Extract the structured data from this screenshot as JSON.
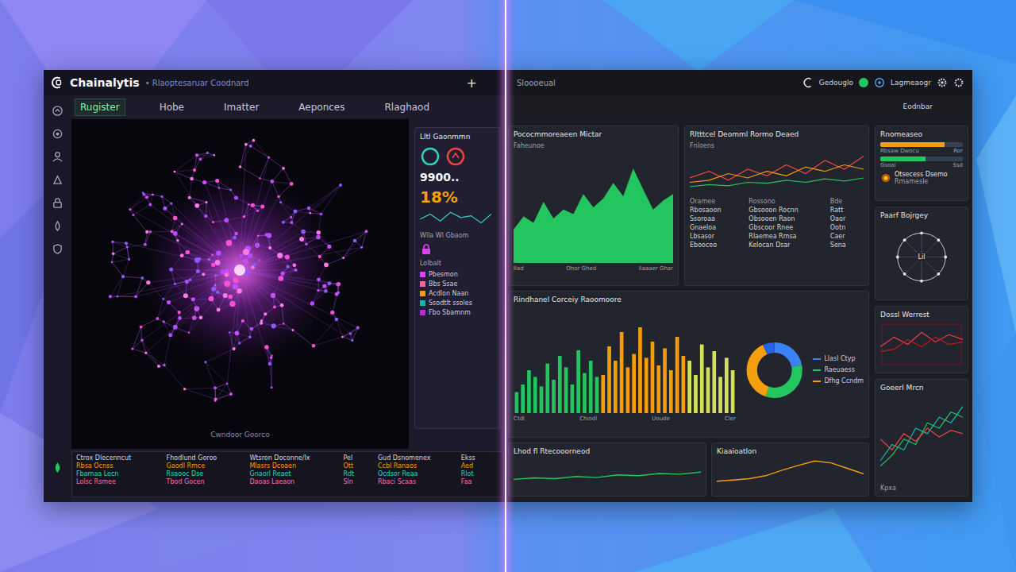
{
  "window": {
    "logo": "Chainalytis",
    "subtitle": "• Rlaoptesaruar Coodnard",
    "add_icon": "+",
    "status_text": "Sloooeual"
  },
  "user_menu": {
    "name": "Gedouglo",
    "online": true,
    "account": "Lagmeaogr"
  },
  "nav_tabs": [
    {
      "label": "Rugister",
      "selected": true
    },
    {
      "label": "Hobe",
      "selected": false
    },
    {
      "label": "Imatter",
      "selected": false
    },
    {
      "label": "Aeponces",
      "selected": false
    },
    {
      "label": "Rlaghaod",
      "selected": false
    }
  ],
  "page_label": "Eodnbar",
  "network": {
    "caption": "Cwndoor Goorco"
  },
  "stats_panel": {
    "title": "Lltl Gaonmmn",
    "total": "9900..",
    "change": "18%",
    "spark": [
      5,
      8,
      4,
      9,
      6,
      7,
      3,
      8
    ],
    "note": "Wlla Wl Gbaom",
    "legend_title": "Lolbalt",
    "legend": [
      {
        "label": "Pbesmon",
        "color": "#e040fb"
      },
      {
        "label": "Bbs Ssae",
        "color": "#ff5fa2"
      },
      {
        "label": "Acdlon Naan",
        "color": "#f59e0b"
      },
      {
        "label": "Ssodtlt ssoles",
        "color": "#14b8a6"
      },
      {
        "label": "Fbo Sbamnm",
        "color": "#c026d3"
      }
    ]
  },
  "activity_table": {
    "columns": [
      "Ctrox Dlecenncut",
      "Fhodlund Goroo",
      "Wtsron Doconne/Ix",
      "Pel",
      "Gud Dsnomenex",
      "Ekss"
    ],
    "rows": [
      {
        "cells": [
          "Rbsa Ocnss",
          "Gaodl Rmce",
          "Mlasrs Dcoaen",
          "Ott",
          "Ccbl Ranaos",
          "Aed"
        ],
        "color": "#f59e0b"
      },
      {
        "cells": [
          "Fbamaa Lecn",
          "Rsaooc Dse",
          "Gnaorl Reaet",
          "Rdt",
          "Ocdsor Reaa",
          "Rlot"
        ],
        "color": "#2dd4bf"
      },
      {
        "cells": [
          "Lolsc Rsmee",
          "Tbod Gocen",
          "Daoas Laeaon",
          "Sln",
          "Rbaci Scaas",
          "Faa"
        ],
        "color": "#f472b6"
      }
    ]
  },
  "area_chart": {
    "title": "Pococmmoreaeen Mictar",
    "subtitle": "Faheunoe",
    "ticks": [
      "Ilad",
      "Ohor Ghed",
      "Ilaaaer Ghar"
    ],
    "values": [
      30,
      42,
      36,
      55,
      40,
      48,
      44,
      62,
      50,
      58,
      72,
      60,
      85,
      66,
      48,
      56,
      62
    ]
  },
  "trend_panel": {
    "title": "Rltttcel Deomml Rormo Deaed",
    "subtitle": "Fnloens",
    "series": [
      {
        "color": "#ef4444",
        "values": [
          40,
          55,
          35,
          60,
          45,
          70,
          50,
          80,
          60,
          90
        ]
      },
      {
        "color": "#f59e0b",
        "values": [
          30,
          35,
          50,
          40,
          55,
          45,
          65,
          55,
          70,
          60
        ]
      },
      {
        "color": "#22c55e",
        "values": [
          20,
          25,
          22,
          30,
          28,
          35,
          30,
          38,
          33,
          40
        ]
      }
    ],
    "columns": [
      "Oramee",
      "Rossono",
      "Bde"
    ],
    "rows": [
      {
        "cells": [
          "Rbosaoon",
          "Gbsooon Rocnn",
          "Ratt"
        ]
      },
      {
        "cells": [
          "Ssoroaa",
          "Obsooen Raon",
          "Oaor"
        ]
      },
      {
        "cells": [
          "Gnaeloa",
          "Gbscoor Rnee",
          "Ootn"
        ]
      },
      {
        "cells": [
          "Lbsasor",
          "Rlaemea Rmsa",
          "Caer"
        ]
      },
      {
        "cells": [
          "Ebooceo",
          "Kelocan Dsar",
          "Sena"
        ]
      }
    ]
  },
  "bar_chart": {
    "title": "Rindhanel Corceiy Raoomoore",
    "ticks": [
      "Ctdl",
      "Chiodl",
      "Uoude",
      "Cler"
    ],
    "series": [
      {
        "color": "#22c55e",
        "values": [
          22,
          30,
          45,
          38,
          28,
          52,
          35,
          60,
          48,
          30,
          66,
          42,
          55,
          38
        ]
      },
      {
        "color": "#f59e0b",
        "values": [
          40,
          70,
          55,
          85,
          48,
          62,
          90,
          58,
          75,
          50,
          68,
          45,
          80,
          60
        ]
      },
      {
        "color": "#d4e157",
        "values": [
          55,
          40,
          72,
          48,
          65,
          38,
          58,
          45
        ]
      }
    ],
    "donut": [
      {
        "value": 22,
        "color": "#3b82f6"
      },
      {
        "value": 33,
        "color": "#22c55e"
      },
      {
        "value": 38,
        "color": "#f59e0b"
      },
      {
        "value": 7,
        "color": "#2563eb"
      }
    ],
    "legend": [
      {
        "label": "Llasl Ctyp",
        "color": "#3b82f6"
      },
      {
        "label": "Raeuaess",
        "color": "#22c55e"
      },
      {
        "label": "Dfhg Ccndm",
        "color": "#f59e0b"
      }
    ]
  },
  "bottom_panels": [
    {
      "title": "Lhod fl Rtecooorneod",
      "color": "#22c55e",
      "values": [
        10,
        14,
        12,
        18,
        15,
        22,
        20,
        26,
        24,
        30
      ]
    },
    {
      "title": "Kiaaioatlon",
      "color": "#f59e0b",
      "values": [
        5,
        8,
        12,
        20,
        35,
        48,
        60,
        55,
        40,
        25
      ]
    }
  ],
  "progress_card": {
    "title": "Rnomeaseo",
    "bars": [
      {
        "label": "Rbsaw Dwocu",
        "reading": "Ror",
        "level": 0.78,
        "color": "#f59e0b"
      },
      {
        "label": "Gsoal",
        "reading": "Ssd",
        "level": 0.55,
        "color": "#22c55e"
      }
    ],
    "item": {
      "title": "Otsecess Dsemo",
      "subtitle": "Rmamesle"
    }
  },
  "orbit_card": {
    "title": "Paarf Bojrgey",
    "center": "Lil"
  },
  "risk_card": {
    "title": "Dossl Werrest",
    "series": [
      {
        "color": "#ef4444",
        "values": [
          40,
          60,
          45,
          70,
          50,
          65,
          55
        ]
      },
      {
        "color": "#b91c1c",
        "values": [
          30,
          35,
          55,
          40,
          60,
          45,
          50
        ]
      }
    ]
  },
  "lines_card": {
    "title": "Goeerl Mrcn",
    "footer": "Kpxa",
    "series": [
      {
        "color": "#14b8a6",
        "values": [
          20,
          35,
          30,
          50,
          45,
          60,
          55,
          70
        ]
      },
      {
        "color": "#22c55e",
        "values": [
          15,
          25,
          40,
          35,
          55,
          50,
          65,
          60
        ]
      },
      {
        "color": "#ef4444",
        "values": [
          40,
          30,
          45,
          38,
          50,
          42,
          48,
          45
        ]
      }
    ]
  }
}
